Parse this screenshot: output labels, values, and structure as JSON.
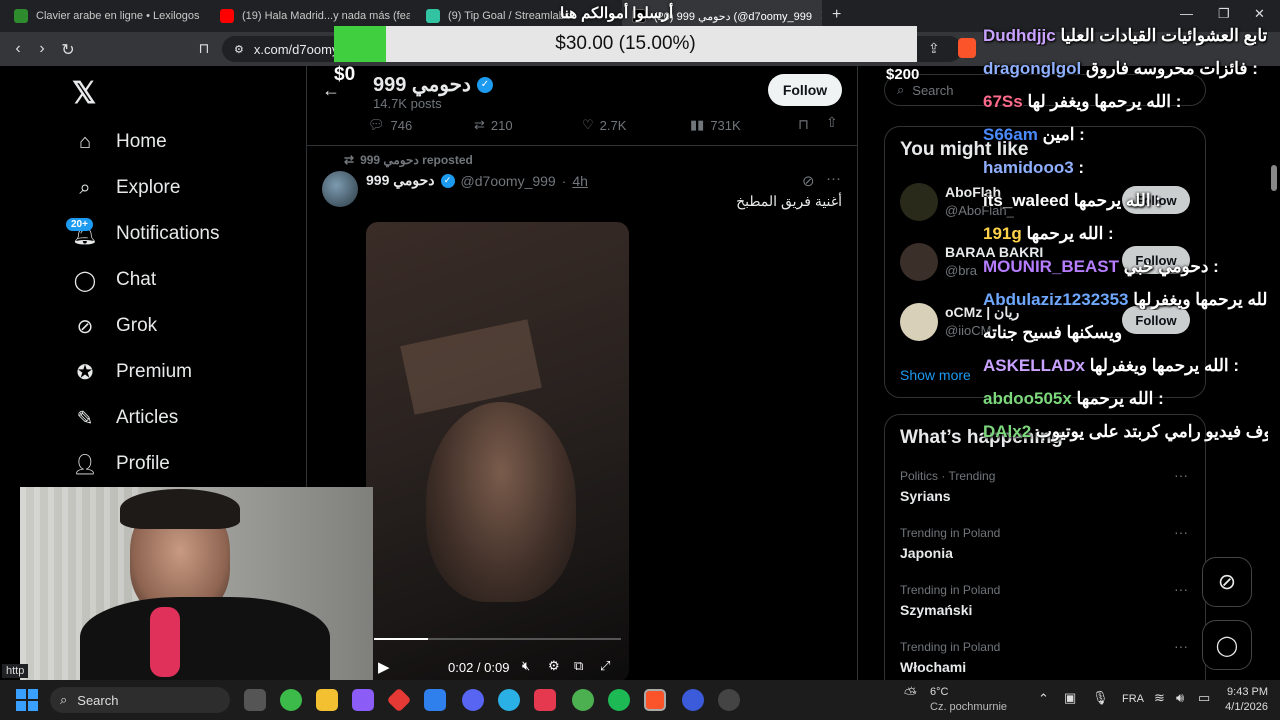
{
  "tabs": [
    {
      "title": "Clavier arabe en ligne • Lexilogos",
      "color": "#2e8b2e"
    },
    {
      "title": "(19) Hala Madrid...y nada más (feat. R",
      "color": "#ff0000"
    },
    {
      "title": "(9) Tip Goal / Streamlabs",
      "color": "#31c3a2"
    },
    {
      "title": "(20) دحومي 999 (@d7oomy_999",
      "color": "#000000"
    }
  ],
  "url": "x.com/d7oomy",
  "overlay": {
    "top_banner": "أرسلوا أموالكم هنا",
    "progress": "$30.00 (15.00%)",
    "goal_min": "$0",
    "goal_max": "$200",
    "progress_fraction": 0.15
  },
  "sidebar": {
    "items": [
      {
        "label": "Home",
        "icon": "home-icon"
      },
      {
        "label": "Explore",
        "icon": "search-icon"
      },
      {
        "label": "Notifications",
        "icon": "bell-icon"
      },
      {
        "label": "Chat",
        "icon": "chat-icon"
      },
      {
        "label": "Grok",
        "icon": "grok-icon"
      },
      {
        "label": "Premium",
        "icon": "premium-icon"
      },
      {
        "label": "Articles",
        "icon": "articles-icon"
      },
      {
        "label": "Profile",
        "icon": "profile-icon"
      }
    ],
    "notif_badge": "20+"
  },
  "profile": {
    "name": "دحومي 999",
    "posts": "14.7K posts",
    "follow": "Follow"
  },
  "stats": {
    "replies": "746",
    "reposts": "210",
    "likes": "2.7K",
    "views": "731K"
  },
  "post": {
    "reposted": "دحومي 999 reposted",
    "author": "دحومي 999",
    "handle": "@d7oomy_999",
    "time": "4h",
    "text": "أغنية فريق المطبخ"
  },
  "video": {
    "time": "0:02 / 0:09",
    "progress_fraction": 0.22
  },
  "right": {
    "search": "Search",
    "might_like": "You might like",
    "suggest": [
      {
        "name": "AboFlah",
        "handle": "@AboFlah_",
        "follow": "Follow"
      },
      {
        "name": "BARAA BAKRI",
        "handle": "@bra",
        "follow": "Follow"
      },
      {
        "name": "oCMz | ريان",
        "handle": "@iioCM",
        "follow": "Follow"
      }
    ],
    "show_more": "Show more",
    "happening": "What’s happening",
    "trends": [
      {
        "meta": "Politics · Trending",
        "name": "Syrians"
      },
      {
        "meta": "Trending in Poland",
        "name": "Japonia"
      },
      {
        "meta": "Trending in Poland",
        "name": "Szymański"
      },
      {
        "meta": "Trending in Poland",
        "name": "Włochami"
      }
    ]
  },
  "chat": [
    {
      "user": "Dudhdjjc",
      "msg": ": تابع العشوائيات القيادات العليا",
      "color": "#c9a3ff"
    },
    {
      "user": "dragonglgol",
      "msg": ": فائزات محروسه فاروق",
      "color": "#8fb0ff"
    },
    {
      "user": "67Ss",
      "msg": ": الله يرحمها ويغفر لها",
      "color": "#ff6b8a"
    },
    {
      "user": "S66am",
      "msg": ": امين",
      "color": "#4a8cff"
    },
    {
      "user": "hamidooo3",
      "msg": ":",
      "color": "#8fb0ff"
    },
    {
      "user": "its_waleed",
      "msg": ": الله يرحمها",
      "color": "#ffffff"
    },
    {
      "user": "191g",
      "msg": ": الله يرحمها",
      "color": "#ffd24a"
    },
    {
      "user": "MOUNIR_BEAST",
      "msg": ": دحومي خبي",
      "color": "#b77dff"
    },
    {
      "user": "Abdulaziz1232353",
      "msg": ": الله يرحمها ويغفرلها",
      "color": "#6fa8ff"
    },
    {
      "user": "",
      "msg": "ويسكنها فسيح جناته",
      "color": "#ffffff"
    },
    {
      "user": "ASKELLADx",
      "msg": ": الله يرحمها ويغفرلها",
      "color": "#c9a3ff"
    },
    {
      "user": "abdoo505x",
      "msg": ": الله يرحمها",
      "color": "#7dd87d"
    },
    {
      "user": "DAlx2",
      "msg": ": شوف فيديو رامي كربتد على يوتيوب",
      "color": "#7dd87d"
    }
  ],
  "taskbar": {
    "search": "Search",
    "weather_temp": "6°C",
    "weather_desc": "Cz. pochmurnie",
    "lang": "FRA",
    "time": "9:43 PM",
    "date": "4/1/2026"
  },
  "status_url": "http"
}
